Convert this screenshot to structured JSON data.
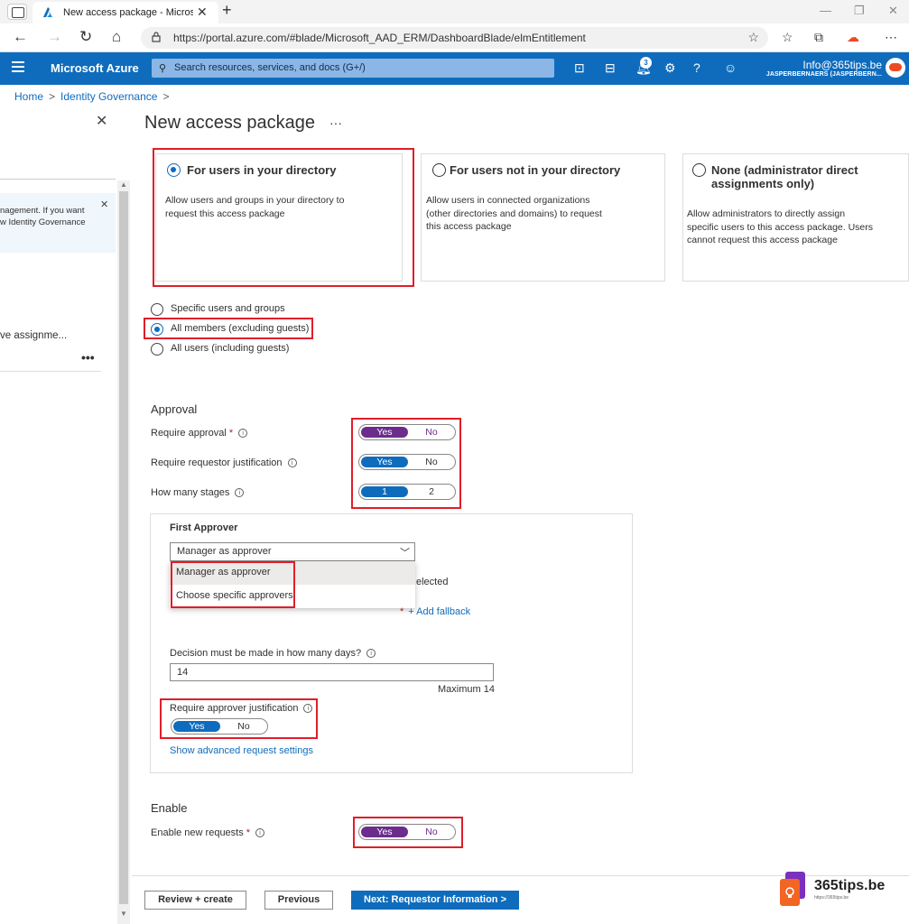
{
  "browser": {
    "tab_title": "New access package - Microsoft",
    "tab_close": "✕",
    "new_tab": "+",
    "url": "https://portal.azure.com/#blade/Microsoft_AAD_ERM/DashboardBlade/elmEntitlement"
  },
  "azure": {
    "brand": "Microsoft Azure",
    "search_placeholder": "Search resources, services, and docs (G+/)",
    "notification_count": "3",
    "user_email": "Info@365tips.be",
    "user_directory": "JASPERBERNAERS (JASPERBERN..."
  },
  "breadcrumb": [
    "Home",
    "Identity Governance"
  ],
  "left_panel": {
    "info_line1": "nagement. If you want",
    "info_line2": "w Identity Governance",
    "item": "ve assignme...",
    "more": "•••"
  },
  "page": {
    "title": "New access package",
    "more": "···"
  },
  "cards": [
    {
      "title": "For users in your directory",
      "desc": [
        "Allow users and groups in your directory to",
        "request this access package"
      ],
      "selected": true
    },
    {
      "title": "For users not in your directory",
      "desc": [
        "Allow users in connected organizations",
        "(other directories and domains) to request",
        "this access package"
      ],
      "selected": false
    },
    {
      "title": "None (administrator direct",
      "title2": "assignments only)",
      "desc": [
        "Allow administrators to directly assign",
        "specific users to this access package. Users",
        "cannot request this access package"
      ],
      "selected": false
    }
  ],
  "scope_options": [
    {
      "label": "Specific users and groups",
      "selected": false
    },
    {
      "label": "All members (excluding guests)",
      "selected": true
    },
    {
      "label": "All users (including guests)",
      "selected": false
    }
  ],
  "approval": {
    "heading": "Approval",
    "require_approval_label": "Require approval",
    "require_justification_label": "Require requestor justification",
    "stages_label": "How many stages",
    "yes": "Yes",
    "no": "No",
    "stage1": "1",
    "stage2": "2"
  },
  "approver": {
    "title": "First Approver",
    "dropdown_value": "Manager as approver",
    "options": [
      "Manager as approver",
      "Choose specific approvers"
    ],
    "hidden_fragment": "elected",
    "add_fallback": "+ Add fallback",
    "days_label": "Decision must be made in how many days?",
    "days_value": "14",
    "days_max": "Maximum 14",
    "justification_label": "Require approver justification",
    "advanced_link": "Show advanced request settings"
  },
  "enable": {
    "heading": "Enable",
    "label": "Enable new requests"
  },
  "footer": {
    "review": "Review + create",
    "previous": "Previous",
    "next": "Next: Requestor Information >"
  },
  "watermark": {
    "text": "365tips.be",
    "sub": "https://365tips.be"
  },
  "colors": {
    "azure_blue": "#0f6cbd",
    "toggle_purple": "#6b2c8c",
    "highlight_red": "#e01e2a"
  }
}
